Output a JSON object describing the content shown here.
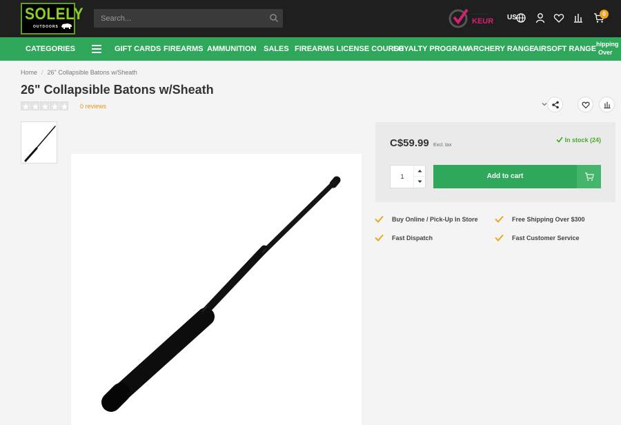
{
  "header": {
    "logo": {
      "name": "SOLELY",
      "sub": "OUTDOORS"
    },
    "search": {
      "placeholder": "Search..."
    },
    "keur": {
      "label": "KEUR",
      "dots": "········"
    },
    "lang": "US",
    "cart_count": "0"
  },
  "nav": {
    "categories": "CATEGORIES",
    "items": [
      "GIFT CARDS",
      "FIREARMS",
      "AMMUNITION",
      "SALES",
      "FIREARMS LICENSE COURSE",
      "LOYALTY PROGRAM",
      "ARCHERY RANGE",
      "AIRSOFT RANGE"
    ],
    "clipped": [
      "hipping",
      "Over"
    ]
  },
  "breadcrumb": {
    "home": "Home",
    "current": "26\" Collapsible Batons w/Sheath"
  },
  "product": {
    "title": "26\" Collapsible Batons w/Sheath",
    "reviews": "0 reviews",
    "rating": 0,
    "price": "C$59.99",
    "excl_tax": "Excl. tax",
    "stock": "In stock (24)",
    "quantity": "1",
    "add_to_cart": "Add to cart"
  },
  "usps": [
    "Buy Online / Pick-Up In Store",
    "Free Shipping Over $300",
    "Fast Dispatch",
    "Fast Customer Service"
  ],
  "colors": {
    "accent": "#2fa85b",
    "header": "#1f1f1f",
    "check": "#f0a51f",
    "stock": "#4aa82f",
    "keur": "#d81f74"
  }
}
